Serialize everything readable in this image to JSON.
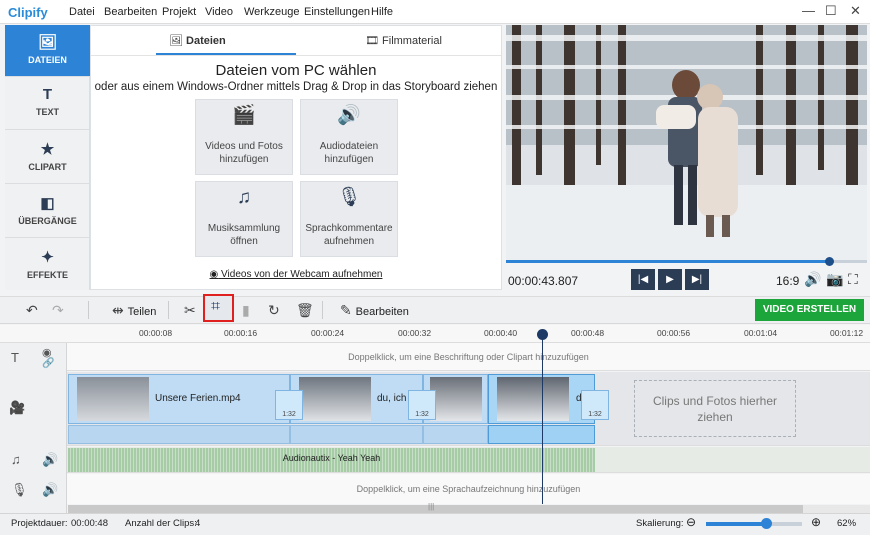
{
  "app": {
    "logo": "Clipify"
  },
  "menu": [
    "Datei",
    "Bearbeiten",
    "Projekt",
    "Video",
    "Werkzeuge",
    "Einstellungen",
    "Hilfe"
  ],
  "window_controls": {
    "minimize": "—",
    "maximize": "☐",
    "close": "✕"
  },
  "sidebar": [
    {
      "label": "DATEIEN",
      "icon": "image-icon",
      "glyph": "🖼"
    },
    {
      "label": "TEXT",
      "icon": "text-icon",
      "glyph": "T"
    },
    {
      "label": "CLIPART",
      "icon": "star-icon",
      "glyph": "★"
    },
    {
      "label": "ÜBERGÄNGE",
      "icon": "transitions-icon",
      "glyph": "◧"
    },
    {
      "label": "EFFEKTE",
      "icon": "magic-wand-icon",
      "glyph": "✦"
    }
  ],
  "panel": {
    "tabs": [
      {
        "label": "Dateien",
        "glyph": "🖼"
      },
      {
        "label": "Filmmaterial",
        "glyph": "🎞"
      }
    ],
    "title": "Dateien vom PC wählen",
    "subtitle": "oder aus einem Windows-Ordner mittels Drag & Drop in das Storyboard ziehen",
    "tiles": [
      {
        "label": "Videos und Fotos hinzufügen",
        "icon": "film-camera-icon",
        "glyph": "🎬"
      },
      {
        "label": "Audiodateien hinzufügen",
        "icon": "audio-file-icon",
        "glyph": "🔊"
      },
      {
        "label": "Musiksammlung öffnen",
        "icon": "music-notes-icon",
        "glyph": "♫"
      },
      {
        "label": "Sprachkommentare aufnehmen",
        "icon": "microphone-icon",
        "glyph": "🎙"
      }
    ],
    "webcam_link": "Videos von der Webcam aufnehmen",
    "webcam_glyph": "◉"
  },
  "player": {
    "time": "00:00:43.807",
    "aspect": "16:9",
    "progress": 0.895,
    "glyphs": {
      "prev": "|◀",
      "play": "▶",
      "next": "▶|",
      "volume": "🔊",
      "snapshot": "📷",
      "fullscreen": "⛶"
    }
  },
  "toolbar": {
    "undo": "↶",
    "redo": "↷",
    "split_glyph": "⇹",
    "split": "Teilen",
    "cut": "✂",
    "crop": "⌗",
    "frame": "▮",
    "rotate": "↻",
    "delete": "🗑",
    "edit_glyph": "✎",
    "edit": "Bearbeiten",
    "create": "VIDEO ERSTELLEN"
  },
  "timeline": {
    "ticks": [
      "00:00:08",
      "00:00:16",
      "00:00:24",
      "00:00:32",
      "00:00:40",
      "00:00:48",
      "00:00:56",
      "00:01:04",
      "00:01:12"
    ],
    "text_hint": "Doppelklick, um eine Beschriftung oder Clipart hinzuzufügen",
    "voice_hint": "Doppelklick, um eine Sprachaufzeichnung hinzuzufügen",
    "clips": [
      "Unsere Ferien.mp4",
      "du, ich u",
      "",
      "d"
    ],
    "transition_duration": "1:32",
    "dropzone": "Clips und Fotos hierher ziehen",
    "audio_label": "Audionautix - Yeah Yeah",
    "track_glyphs": {
      "text": "T",
      "eye": "◉",
      "link": "🔗",
      "video": "🎥",
      "music": "♫",
      "speaker": "🔊",
      "mic": "🎙"
    },
    "scroll_grip": "|||"
  },
  "status": {
    "duration_label": "Projektdauer:",
    "duration": "00:00:48",
    "clips_label": "Anzahl der Clips:",
    "clips": "4",
    "zoom_label": "Skalierung:",
    "zoom_minus": "⊖",
    "zoom_plus": "⊕",
    "zoom": "62%",
    "zoom_level": 0.62
  }
}
